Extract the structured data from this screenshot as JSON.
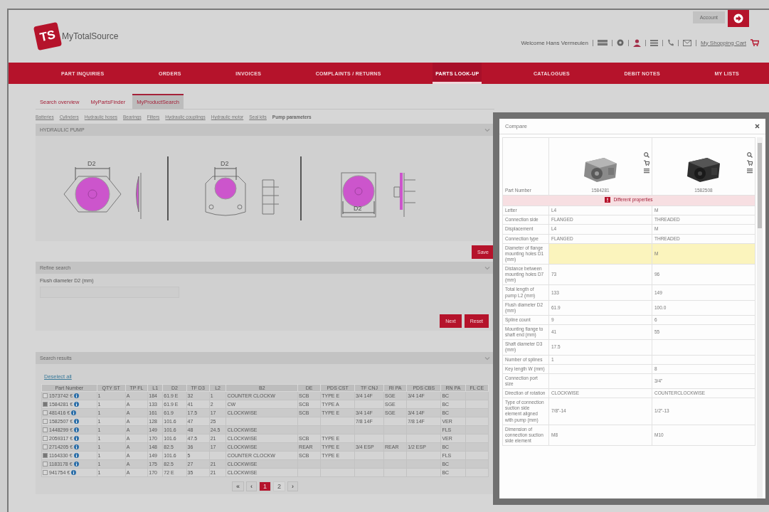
{
  "header": {
    "logo_mark": "TS",
    "logo_text": "MyTotalSource",
    "welcome": "Welcome Hans Vermeulen",
    "account": "Account",
    "cart_link": "My Shopping Cart"
  },
  "nav": [
    {
      "label": "PART INQUIRIES",
      "selected": false
    },
    {
      "label": "ORDERS",
      "selected": false
    },
    {
      "label": "INVOICES",
      "selected": false
    },
    {
      "label": "COMPLAINTS / RETURNS",
      "selected": false
    },
    {
      "label": "PARTS LOOK-UP",
      "selected": true
    },
    {
      "label": "CATALOGUES",
      "selected": false
    },
    {
      "label": "DEBIT NOTES",
      "selected": false
    },
    {
      "label": "MY LISTS",
      "selected": false
    }
  ],
  "search_tabs": [
    {
      "label": "Search overview",
      "selected": false
    },
    {
      "label": "MyPartsFinder",
      "selected": false
    },
    {
      "label": "MyProductSearch",
      "selected": true
    }
  ],
  "categories": [
    {
      "label": "Batteries",
      "selected": false
    },
    {
      "label": "Cylinders",
      "selected": false
    },
    {
      "label": "Hydraulic hoses",
      "selected": false
    },
    {
      "label": "Bearings",
      "selected": false
    },
    {
      "label": "Filters",
      "selected": false
    },
    {
      "label": "Hydraulic couplings",
      "selected": false
    },
    {
      "label": "Hydraulic motor",
      "selected": false
    },
    {
      "label": "Seal kits",
      "selected": false
    },
    {
      "label": "Pump parameters",
      "selected": true
    }
  ],
  "pump_panel": {
    "title": "HYDRAULIC PUMP",
    "drawings": [
      {
        "dimension": "D2",
        "kind": "oval"
      },
      {
        "dimension": "D2",
        "kind": "round"
      },
      {
        "dimension": "D2",
        "kind": "square"
      }
    ],
    "button": "Save"
  },
  "refine_panel": {
    "title": "Refine search",
    "field_label": "Flush diameter D2 (mm)",
    "buttons": [
      "Next",
      "Reset"
    ]
  },
  "results_panel": {
    "title": "Search results",
    "deselect": "Deselect all",
    "columns": [
      "Part Number",
      "QTY ST",
      "TP FL",
      "L1",
      "D2",
      "TF D3",
      "L2",
      "B2",
      "DE",
      "PDS CST",
      "TF CNJ",
      "RI PA",
      "PDS CBS",
      "RN PA",
      "FL CE"
    ],
    "rows": [
      {
        "checked": false,
        "currency": "€",
        "cells": [
          "1573742",
          "1",
          "A",
          "184",
          "61.9 E",
          "32",
          "1",
          "COUNTER CLOCKW",
          "SCB",
          "TYPE E",
          "3/4 14F",
          "SGE",
          "3/4 14F",
          "BC"
        ]
      },
      {
        "checked": true,
        "currency": "€",
        "cells": [
          "1584281",
          "1",
          "A",
          "133",
          "61.9 E",
          "41",
          "2",
          "CW",
          "SCB",
          "TYPE A",
          "",
          "SGE",
          "",
          "BC"
        ]
      },
      {
        "checked": false,
        "currency": "€",
        "cells": [
          "481416",
          "1",
          "A",
          "161",
          "61.9",
          "17.5",
          "17",
          "CLOCKWISE",
          "SCB",
          "TYPE E",
          "3/4 14F",
          "SGE",
          "3/4 14F",
          "BC"
        ]
      },
      {
        "checked": false,
        "currency": "€",
        "cells": [
          "1582507",
          "1",
          "A",
          "128",
          "101.6",
          "47",
          "25",
          "",
          "",
          "",
          "7/8 14F",
          "",
          "7/8 14F",
          "VER"
        ]
      },
      {
        "checked": false,
        "currency": "€",
        "cells": [
          "1448299",
          "1",
          "A",
          "149",
          "101.6",
          "48",
          "24.5",
          "CLOCKWISE",
          "",
          "",
          "",
          "",
          "",
          "FLS"
        ]
      },
      {
        "checked": false,
        "currency": "€",
        "cells": [
          "2059317",
          "1",
          "A",
          "170",
          "101.6",
          "47.5",
          "21",
          "CLOCKWISE",
          "SCB",
          "TYPE E",
          "",
          "",
          "",
          "VER"
        ]
      },
      {
        "checked": false,
        "currency": "€",
        "cells": [
          "2714205",
          "1",
          "A",
          "148",
          "82.5",
          "36",
          "17",
          "CLOCKWISE",
          "REAR",
          "TYPE E",
          "3/4 ESP",
          "REAR",
          "1/2 ESP",
          "BC"
        ]
      },
      {
        "checked": true,
        "currency": "€",
        "cells": [
          "1164330",
          "1",
          "A",
          "149",
          "101.6",
          "5",
          "",
          "COUNTER CLOCKW",
          "SCB",
          "TYPE E",
          "",
          "",
          "",
          "FLS"
        ]
      },
      {
        "checked": false,
        "currency": "€",
        "cells": [
          "1183178",
          "1",
          "A",
          "175",
          "82.5",
          "27",
          "21",
          "CLOCKWISE",
          "",
          "",
          "",
          "",
          "",
          "BC"
        ]
      },
      {
        "checked": false,
        "currency": "€",
        "cells": [
          "941754",
          "1",
          "A",
          "170",
          "72 E",
          "35",
          "21",
          "CLOCKWISE",
          "",
          "",
          "",
          "",
          "",
          "BC"
        ]
      }
    ],
    "pagination": [
      {
        "label": "«",
        "kind": "nav",
        "selected": false
      },
      {
        "label": "‹",
        "kind": "nav",
        "selected": false
      },
      {
        "label": "1",
        "kind": "page",
        "selected": true
      },
      {
        "label": "2",
        "kind": "page",
        "selected": false
      },
      {
        "label": "›",
        "kind": "nav",
        "selected": false
      }
    ]
  },
  "compare": {
    "title": "Compare",
    "first_label": "Part Number",
    "products": [
      {
        "part": "1584281"
      },
      {
        "part": "1582508"
      }
    ],
    "banner": "Different properties",
    "rows": [
      {
        "label": "Letter",
        "value_1": "L4",
        "value_2": "M",
        "highlight": false
      },
      {
        "label": "Connection side",
        "value_1": "FLANGED",
        "value_2": "THREADED",
        "highlight": false
      },
      {
        "label": "Displacement",
        "value_1": "L4",
        "value_2": "M",
        "highlight": false
      },
      {
        "label": "Connection type",
        "value_1": "FLANGED",
        "value_2": "THREADED",
        "highlight": false
      },
      {
        "label": "Diameter of flange mounting holes D1 (mm)",
        "value_2": "M",
        "highlight": true
      },
      {
        "label": "Distance between mounting holes D7 (mm)",
        "value_1": "73",
        "value_2": "96",
        "highlight": false
      },
      {
        "label": "Total length of pump L2 (mm)",
        "value_1": "133",
        "value_2": "149",
        "highlight": false
      },
      {
        "label": "Flush diameter D2 (mm)",
        "value_1": "61.9",
        "value_2": "100.0",
        "highlight": false
      },
      {
        "label": "Spline count",
        "value_1": "9",
        "value_2": "6",
        "highlight": false
      },
      {
        "label": "Mounting flange to shaft end (mm)",
        "value_1": "41",
        "value_2": "55",
        "highlight": false
      },
      {
        "label": "Shaft diameter D3 (mm)",
        "value_1": "17.5",
        "highlight": false
      },
      {
        "label": "Number of splines",
        "value_1": "1",
        "highlight": false
      },
      {
        "label": "Key length W (mm)",
        "value_2": "8",
        "highlight": false
      },
      {
        "label": "Connection port size",
        "value_2": "3/4\"",
        "highlight": false
      },
      {
        "label": "Direction of rotation",
        "value_1": "CLOCKWISE",
        "value_2": "COUNTERCLOCKWISE",
        "highlight": false
      },
      {
        "label": "Type of connection suction side element aligned with pump (mm)",
        "value_1": "7/8\"-14",
        "value_2": "1/2\"-13",
        "highlight": false
      },
      {
        "label": "Dimension of connection suction side element",
        "value_1": "M8",
        "value_2": "M10",
        "highlight": false
      }
    ]
  }
}
